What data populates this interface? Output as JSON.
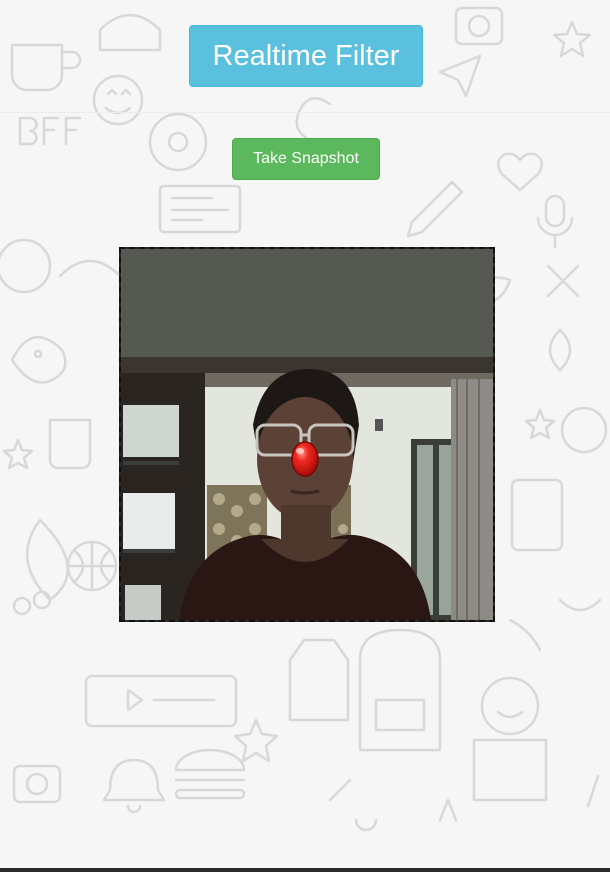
{
  "header": {
    "title": "Realtime Filter"
  },
  "controls": {
    "snapshot_label": "Take Snapshot"
  },
  "video": {
    "overlay": "red-clown-nose-filter"
  },
  "colors": {
    "title_button": "#5bc0de",
    "snapshot_button": "#5cb85c",
    "background": "#f6f6f6",
    "doodle": "#d9d9d9",
    "nose": "#e0221a"
  }
}
